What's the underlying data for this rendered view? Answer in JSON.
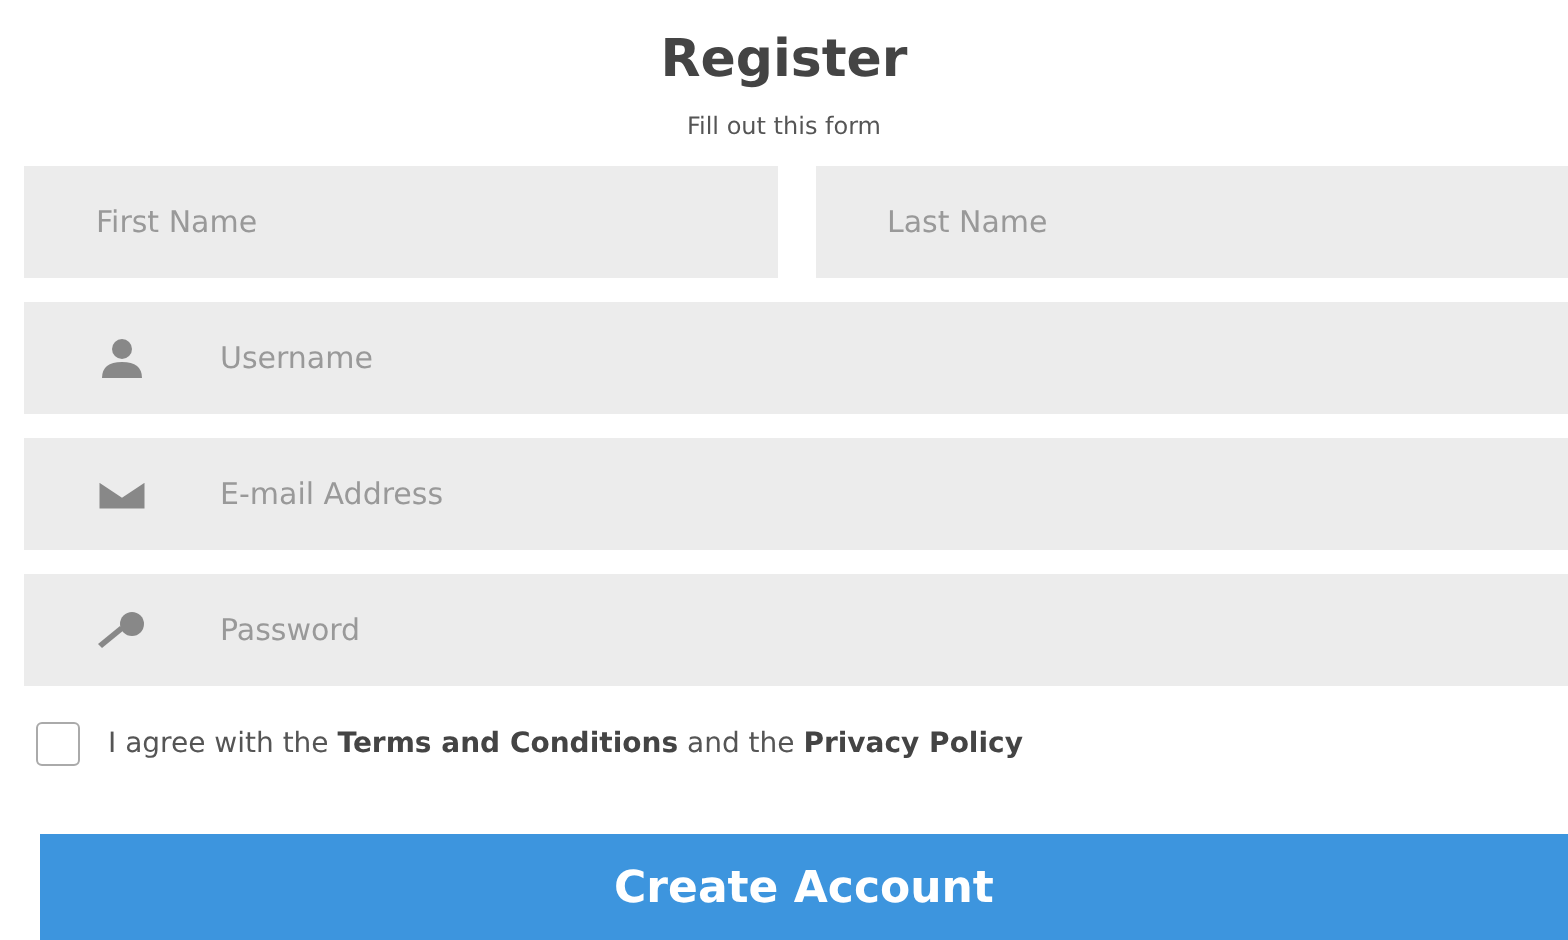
{
  "title": "Register",
  "subtitle": "Fill out this form",
  "name_fields": [
    {
      "placeholder": "First Name"
    },
    {
      "placeholder": "Last Name"
    }
  ],
  "fields": [
    {
      "kind": "user",
      "placeholder": "Username"
    },
    {
      "kind": "mail",
      "placeholder": "E-mail Address"
    },
    {
      "kind": "key",
      "placeholder": "Password"
    }
  ],
  "agree": {
    "checked": false,
    "text": "I agree with the **Terms and Conditions** and the **Privacy Policy**"
  },
  "button": "Create Account"
}
